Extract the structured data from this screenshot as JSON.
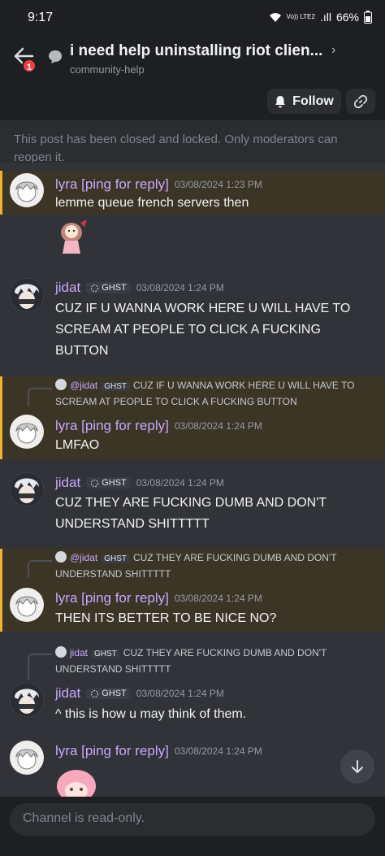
{
  "status_bar": {
    "time": "9:17",
    "network": "Vo)) LTE2",
    "signal": ".ıll",
    "battery": "66%"
  },
  "header": {
    "badge_count": "1",
    "title": "i need help uninstalling riot clien...",
    "subtitle": "community-help",
    "chevron": "›"
  },
  "actions": {
    "follow_label": "Follow"
  },
  "locked_notice": "This post has been closed and locked. Only moderators can reopen it.",
  "messages": [
    {
      "author": "lyra [ping for reply]",
      "time": "03/08/2024 1:23 PM",
      "text": "lemme queue french servers then"
    },
    {
      "author": "jidat",
      "tag": "GHST",
      "time": "03/08/2024 1:24 PM",
      "text": "CUZ IF U WANNA WORK HERE U WILL HAVE TO SCREAM AT PEOPLE TO CLICK A FUCKING BUTTON"
    },
    {
      "reply_author": "@jidat",
      "reply_tag": "GHST",
      "reply_text": "CUZ IF U WANNA WORK HERE U WILL HAVE TO SCREAM AT PEOPLE TO CLICK A FUCKING BUTTON",
      "author": "lyra [ping for reply]",
      "time": "03/08/2024 1:24 PM",
      "text": "LMFAO"
    },
    {
      "author": "jidat",
      "tag": "GHST",
      "time": "03/08/2024 1:24 PM",
      "text": "CUZ THEY ARE FUCKING DUMB AND DON'T UNDERSTAND SHITTTTT"
    },
    {
      "reply_author": "@jidat",
      "reply_tag": "GHST",
      "reply_text": "CUZ THEY ARE FUCKING DUMB AND DON'T UNDERSTAND SHITTTTT",
      "author": "lyra [ping for reply]",
      "time": "03/08/2024 1:24 PM",
      "text": "THEN ITS BETTER TO BE NICE NO?"
    },
    {
      "reply_author": "jidat",
      "reply_tag": "GHST",
      "reply_text": "CUZ THEY ARE FUCKING DUMB AND DON'T UNDERSTAND SHITTTTT",
      "author": "jidat",
      "tag": "GHST",
      "time": "03/08/2024 1:24 PM",
      "text": "^ this is how u may think of them."
    },
    {
      "author": "lyra [ping for reply]",
      "time": "03/08/2024 1:24 PM",
      "text": ""
    }
  ],
  "composer": {
    "placeholder": "Channel is read-only."
  }
}
